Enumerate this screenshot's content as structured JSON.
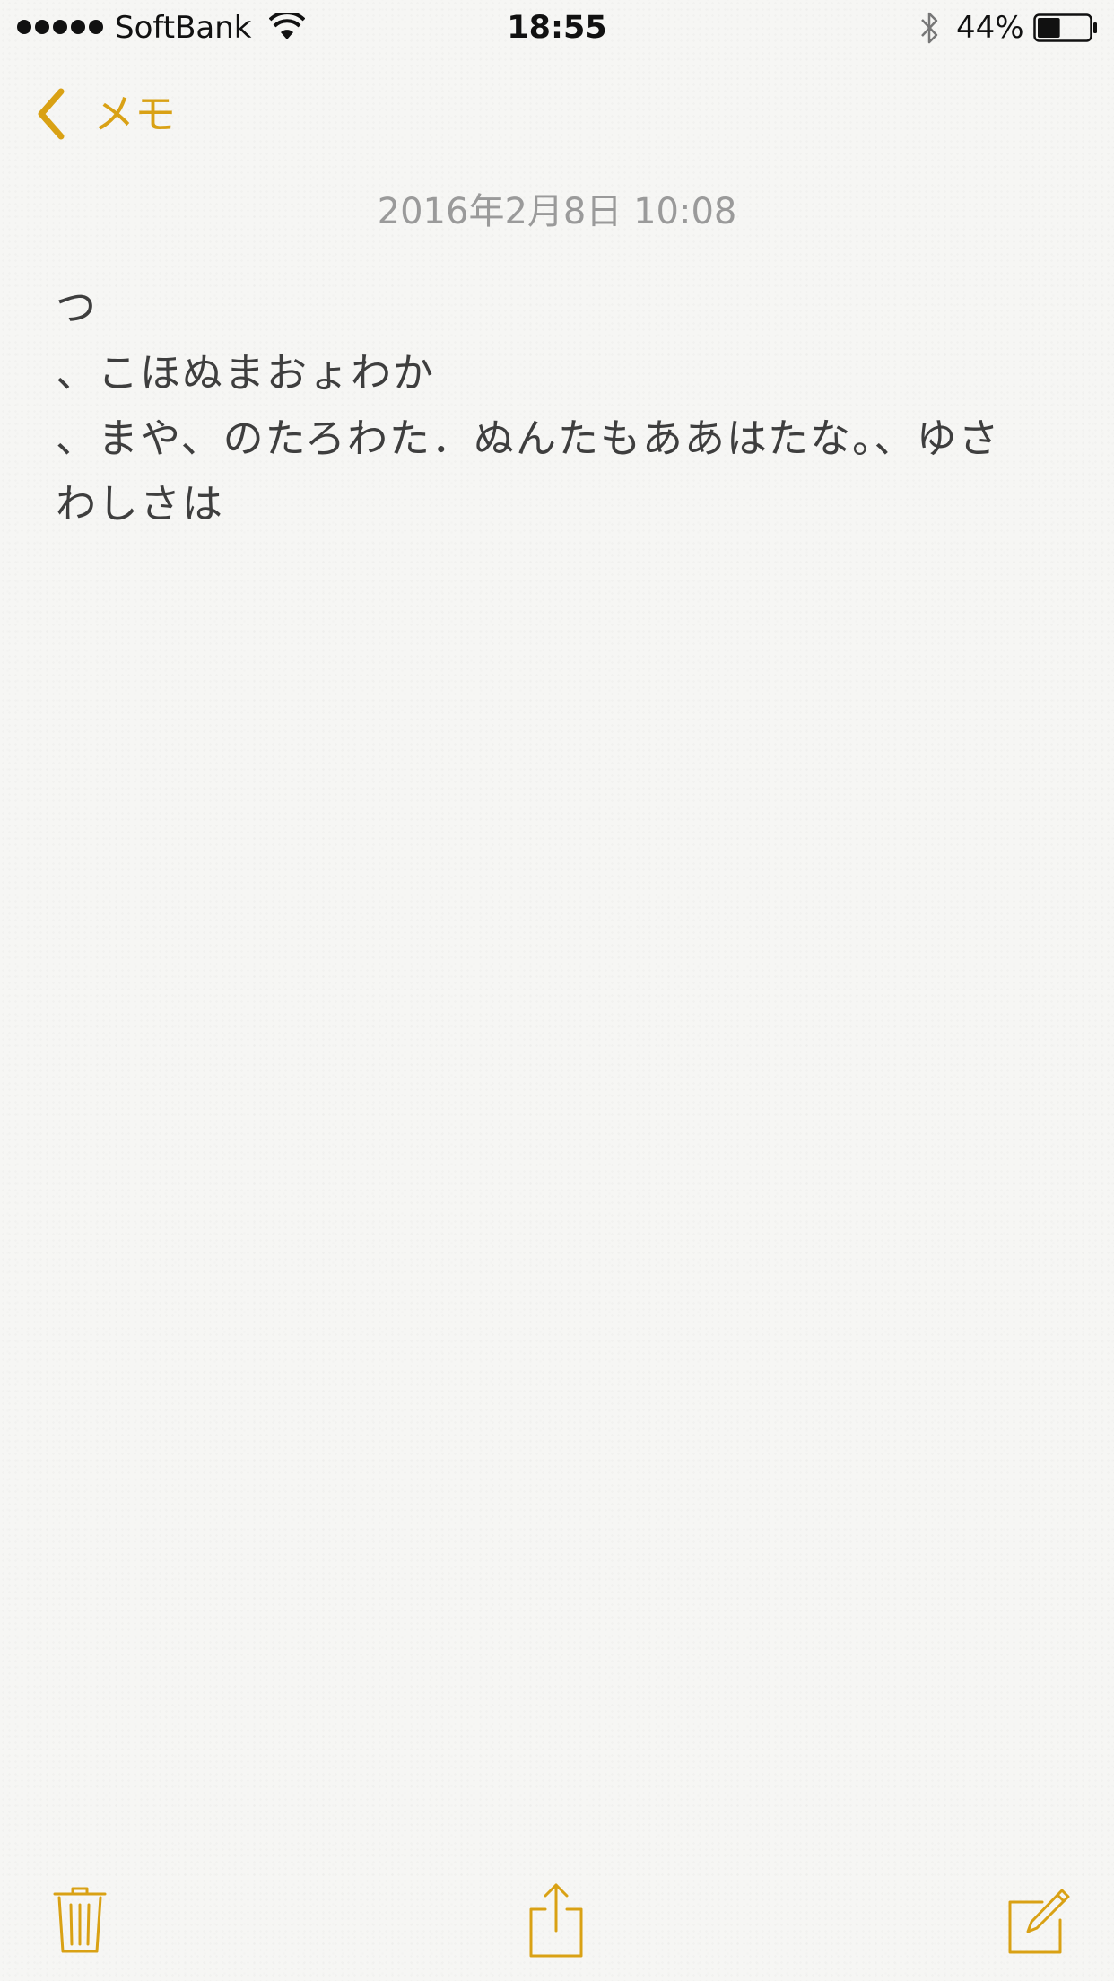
{
  "status_bar": {
    "signal_bars": 5,
    "carrier": "SoftBank",
    "time": "18:55",
    "battery_percent_text": "44%",
    "battery_level": 0.44,
    "icons": [
      "signal-dots",
      "wifi-icon",
      "bluetooth-icon",
      "battery-icon"
    ]
  },
  "nav": {
    "back_label": "メモ",
    "back_icon": "chevron-left-icon"
  },
  "note": {
    "date": "2016年2月8日 10:08",
    "lines": [
      "つ",
      "、こほぬまおょわか",
      "、まや、のたろわた．ぬんたもああはたな。、ゆさ",
      "わしさは"
    ]
  },
  "toolbar": {
    "icons": [
      "trash-icon",
      "share-icon",
      "compose-icon"
    ]
  },
  "colors": {
    "accent": "#d9a114",
    "background": "#f6f6f4",
    "text": "#3e3e3e",
    "date_text": "#9a9a9a"
  }
}
